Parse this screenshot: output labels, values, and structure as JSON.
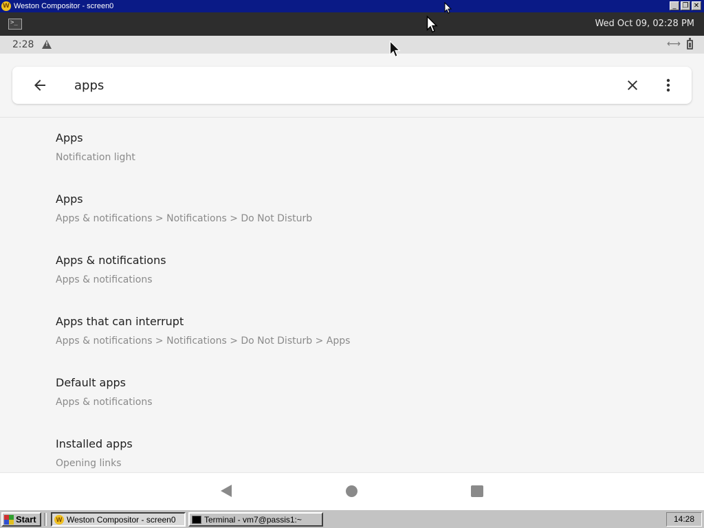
{
  "window": {
    "title": "Weston Compositor - screen0",
    "icon": "weston-icon",
    "controls": [
      "minimize",
      "restore",
      "close"
    ]
  },
  "weston_panel": {
    "launcher_icon": "terminal-icon",
    "clock": "Wed Oct 09, 02:28 PM"
  },
  "android_status": {
    "time": "2:28",
    "icons": [
      "warning-icon",
      "link-icon",
      "battery-icon"
    ]
  },
  "search": {
    "query": "apps",
    "icons": [
      "back-arrow-icon",
      "close-icon",
      "more-vert-icon"
    ]
  },
  "results": [
    {
      "title": "Apps",
      "summary": "Notification light"
    },
    {
      "title": "Apps",
      "summary": "Apps & notifications > Notifications > Do Not Disturb"
    },
    {
      "title": "Apps & notifications",
      "summary": "Apps & notifications"
    },
    {
      "title": "Apps that can interrupt",
      "summary": "Apps & notifications > Notifications > Do Not Disturb > Apps"
    },
    {
      "title": "Default apps",
      "summary": "Apps & notifications"
    },
    {
      "title": "Installed apps",
      "summary": "Opening links"
    }
  ],
  "nav_bar": {
    "icons": [
      "nav-back-icon",
      "nav-home-icon",
      "nav-recents-icon"
    ]
  },
  "taskbar": {
    "start_label": "Start",
    "tasks": [
      {
        "label": "Weston Compositor - screen0",
        "active": true
      },
      {
        "label": "Terminal - vm7@passis1:~",
        "active": false
      }
    ],
    "clock": "14:28"
  }
}
